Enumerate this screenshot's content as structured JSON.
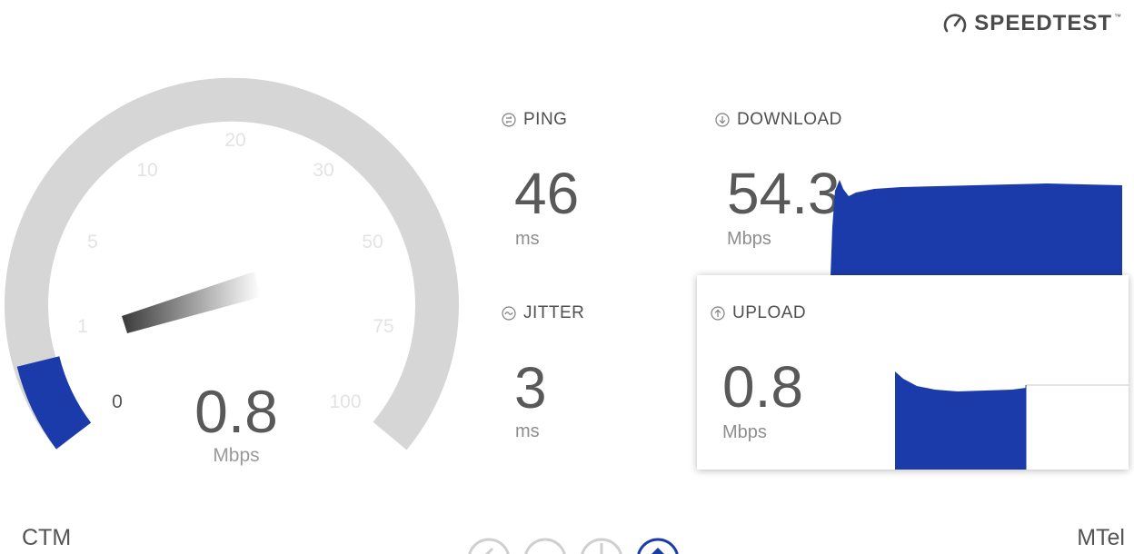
{
  "brand": {
    "name": "SPEEDTEST",
    "tm": "™",
    "icon": "gauge-icon"
  },
  "gauge": {
    "ticks": [
      "0",
      "1",
      "5",
      "10",
      "20",
      "30",
      "50",
      "75",
      "100"
    ],
    "value": "0.8",
    "unit": "Mbps",
    "fill_fraction": 0.13,
    "track_color": "#d6d6d6",
    "fill_color": "#1b3bab"
  },
  "ping": {
    "label": "PING",
    "value": "46",
    "unit": "ms",
    "icon": "ping-icon"
  },
  "jitter": {
    "label": "JITTER",
    "value": "3",
    "unit": "ms",
    "icon": "jitter-icon"
  },
  "download": {
    "label": "DOWNLOAD",
    "value": "54.3",
    "unit": "Mbps",
    "icon": "download-arrow-icon",
    "color": "#1b3bab"
  },
  "upload": {
    "label": "UPLOAD",
    "value": "0.8",
    "unit": "Mbps",
    "icon": "upload-arrow-icon",
    "color": "#1b3bab"
  },
  "footer": {
    "isp": "CTM",
    "server": "MTel"
  },
  "nav": {
    "icons": [
      "back-icon",
      "circle-icon",
      "download-icon",
      "upload-icon"
    ],
    "active_index": 3
  }
}
